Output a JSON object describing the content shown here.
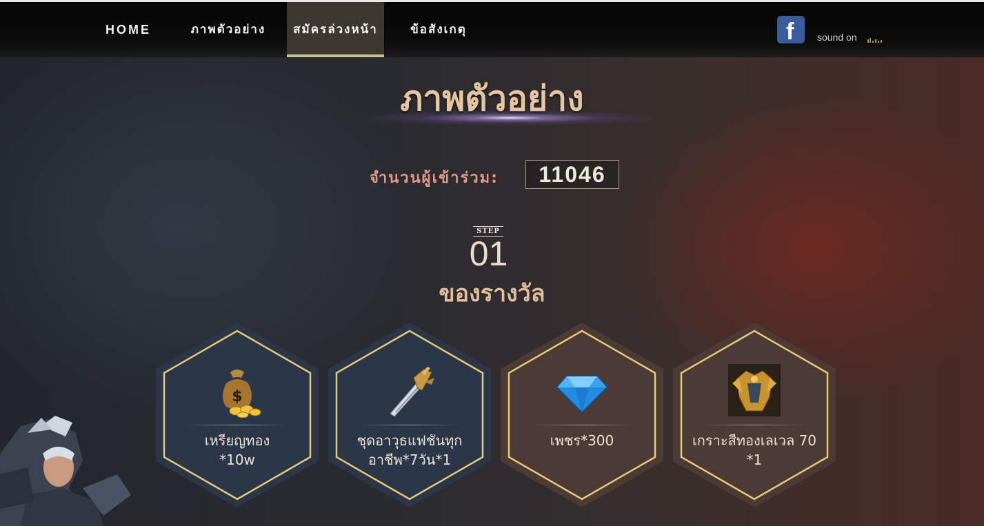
{
  "nav": {
    "items": [
      {
        "label": "HOME"
      },
      {
        "label": "ภาพตัวอย่าง"
      },
      {
        "label": "สมัครล่วงหน้า"
      },
      {
        "label": "ข้อสังเกตุ"
      }
    ],
    "active_index": 2,
    "facebook_icon": "facebook-icon",
    "sound_label": "sound on",
    "sound_icon": "sound-bars-icon"
  },
  "header": {
    "title": "ภาพตัวอย่าง"
  },
  "participants": {
    "label": "จำนวนผู้เข้าร่วม:",
    "count": "11046"
  },
  "step": {
    "word": "STEP",
    "number": "01",
    "title": "ของรางวัล"
  },
  "rewards": [
    {
      "line1": "เหรียญทอง",
      "line2": "*10w",
      "icon": "gold-coin-bag-icon",
      "theme": "blue"
    },
    {
      "line1": "ชุดอาวุธแฟชันทุก",
      "line2": "อาชีพ*7วัน*1",
      "icon": "sword-icon",
      "theme": "blue"
    },
    {
      "line1": "เพชร*300",
      "line2": "",
      "icon": "diamond-icon",
      "theme": "brown"
    },
    {
      "line1": "เกราะสีทองเลเวล 70",
      "line2": "*1",
      "icon": "golden-armor-icon",
      "theme": "brown"
    }
  ],
  "colors": {
    "accent_gold": "#c9c18a",
    "hex_border_gold": "#e7c873",
    "hex_blue_fill": "#2b3748",
    "hex_brown_fill": "#4c3a37",
    "participants_label": "#e59a83"
  }
}
